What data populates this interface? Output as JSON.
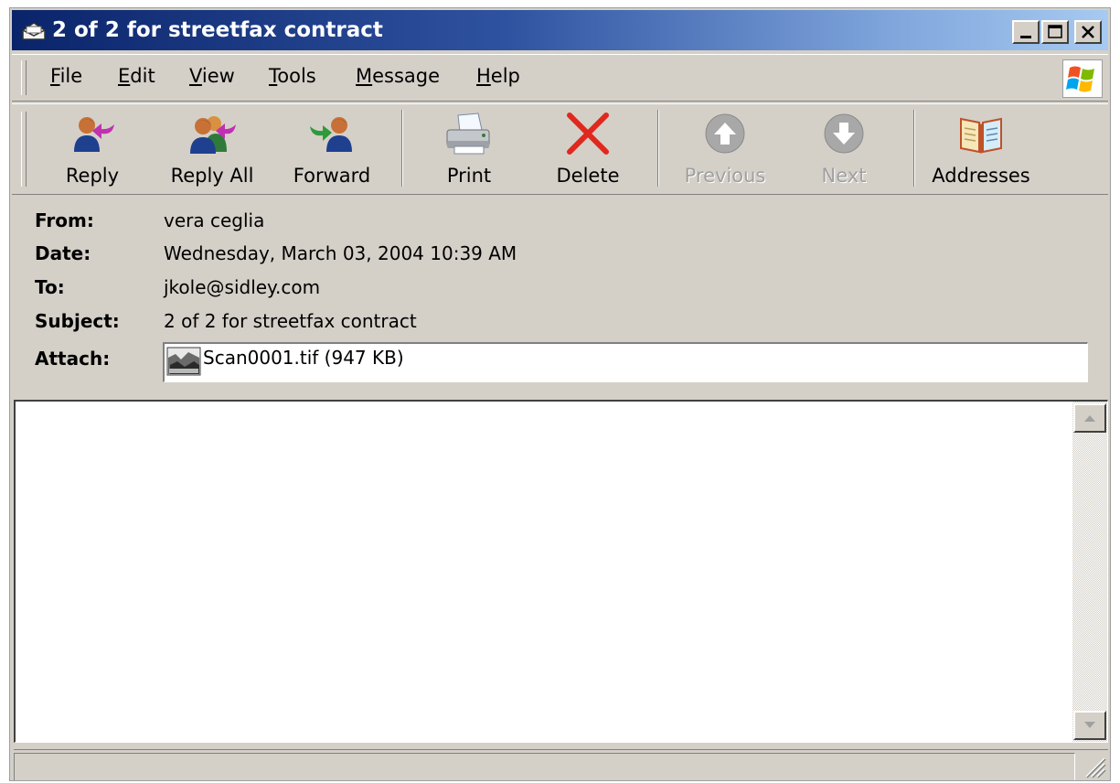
{
  "window": {
    "title": "2 of 2 for streetfax contract",
    "controls": [
      "minimize",
      "maximize",
      "close"
    ]
  },
  "menu": {
    "items": [
      {
        "label": "File",
        "accel": "F"
      },
      {
        "label": "Edit",
        "accel": "E"
      },
      {
        "label": "View",
        "accel": "V"
      },
      {
        "label": "Tools",
        "accel": "T"
      },
      {
        "label": "Message",
        "accel": "M"
      },
      {
        "label": "Help",
        "accel": "H"
      }
    ]
  },
  "toolbar": {
    "buttons": [
      {
        "label": "Reply",
        "icon": "reply-icon",
        "enabled": true
      },
      {
        "label": "Reply All",
        "icon": "reply-all-icon",
        "enabled": true
      },
      {
        "label": "Forward",
        "icon": "forward-icon",
        "enabled": true
      },
      {
        "label": "Print",
        "icon": "printer-icon",
        "enabled": true
      },
      {
        "label": "Delete",
        "icon": "delete-x-icon",
        "enabled": true
      },
      {
        "label": "Previous",
        "icon": "up-arrow-icon",
        "enabled": false
      },
      {
        "label": "Next",
        "icon": "down-arrow-icon",
        "enabled": false
      },
      {
        "label": "Addresses",
        "icon": "address-book-icon",
        "enabled": true
      }
    ]
  },
  "header": {
    "from_label": "From:",
    "from": "vera ceglia",
    "date_label": "Date:",
    "date": "Wednesday, March 03, 2004 10:39 AM",
    "to_label": "To:",
    "to": "jkole@sidley.com",
    "subject_label": "Subject:",
    "subject": "2 of 2 for streetfax contract",
    "attach_label": "Attach:",
    "attachment": "Scan0001.tif (947 KB)"
  },
  "colors": {
    "titlebar_start": "#0a246a",
    "titlebar_end": "#a6caf0",
    "window_face": "#d4d0c8",
    "disabled_text": "#a0a0a0",
    "delete_red": "#e0281e"
  }
}
